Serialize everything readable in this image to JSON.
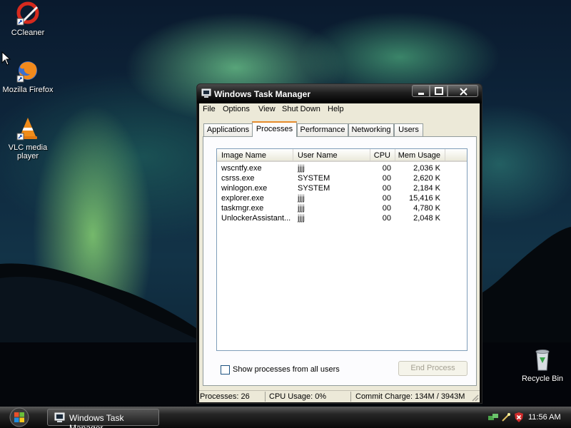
{
  "desktop": {
    "icons": [
      {
        "label": "CCleaner",
        "icon": "ccleaner-icon"
      },
      {
        "label": "Mozilla Firefox",
        "icon": "firefox-icon"
      },
      {
        "label": "VLC media player",
        "icon": "vlc-icon"
      },
      {
        "label": "Recycle Bin",
        "icon": "recycle-bin-icon"
      }
    ]
  },
  "window": {
    "title": "Windows Task Manager",
    "menu": [
      "File",
      "Options",
      "View",
      "Shut Down",
      "Help"
    ],
    "tabs": [
      "Applications",
      "Processes",
      "Performance",
      "Networking",
      "Users"
    ],
    "active_tab": "Processes",
    "columns": [
      "Image Name",
      "User Name",
      "CPU",
      "Mem Usage"
    ],
    "rows": [
      [
        "wscntfy.exe",
        "jjjj",
        "00",
        "2,036 K"
      ],
      [
        "csrss.exe",
        "SYSTEM",
        "00",
        "2,620 K"
      ],
      [
        "winlogon.exe",
        "SYSTEM",
        "00",
        "2,184 K"
      ],
      [
        "explorer.exe",
        "jjjj",
        "00",
        "15,416 K"
      ],
      [
        "taskmgr.exe",
        "jjjj",
        "00",
        "4,780 K"
      ],
      [
        "UnlockerAssistant...",
        "jjjj",
        "00",
        "2,048 K"
      ]
    ],
    "show_all_label": "Show processes from all users",
    "end_process_label": "End Process",
    "status": {
      "processes": "Processes: 26",
      "cpu": "CPU Usage: 0%",
      "commit": "Commit Charge: 134M / 3943M"
    }
  },
  "taskbar": {
    "task_label": "Windows Task Manager",
    "clock": "11:56 AM"
  },
  "colors": {
    "tab_highlight": "#e68b2c",
    "list_border": "#7f9db9",
    "window_face": "#ece9d8"
  }
}
